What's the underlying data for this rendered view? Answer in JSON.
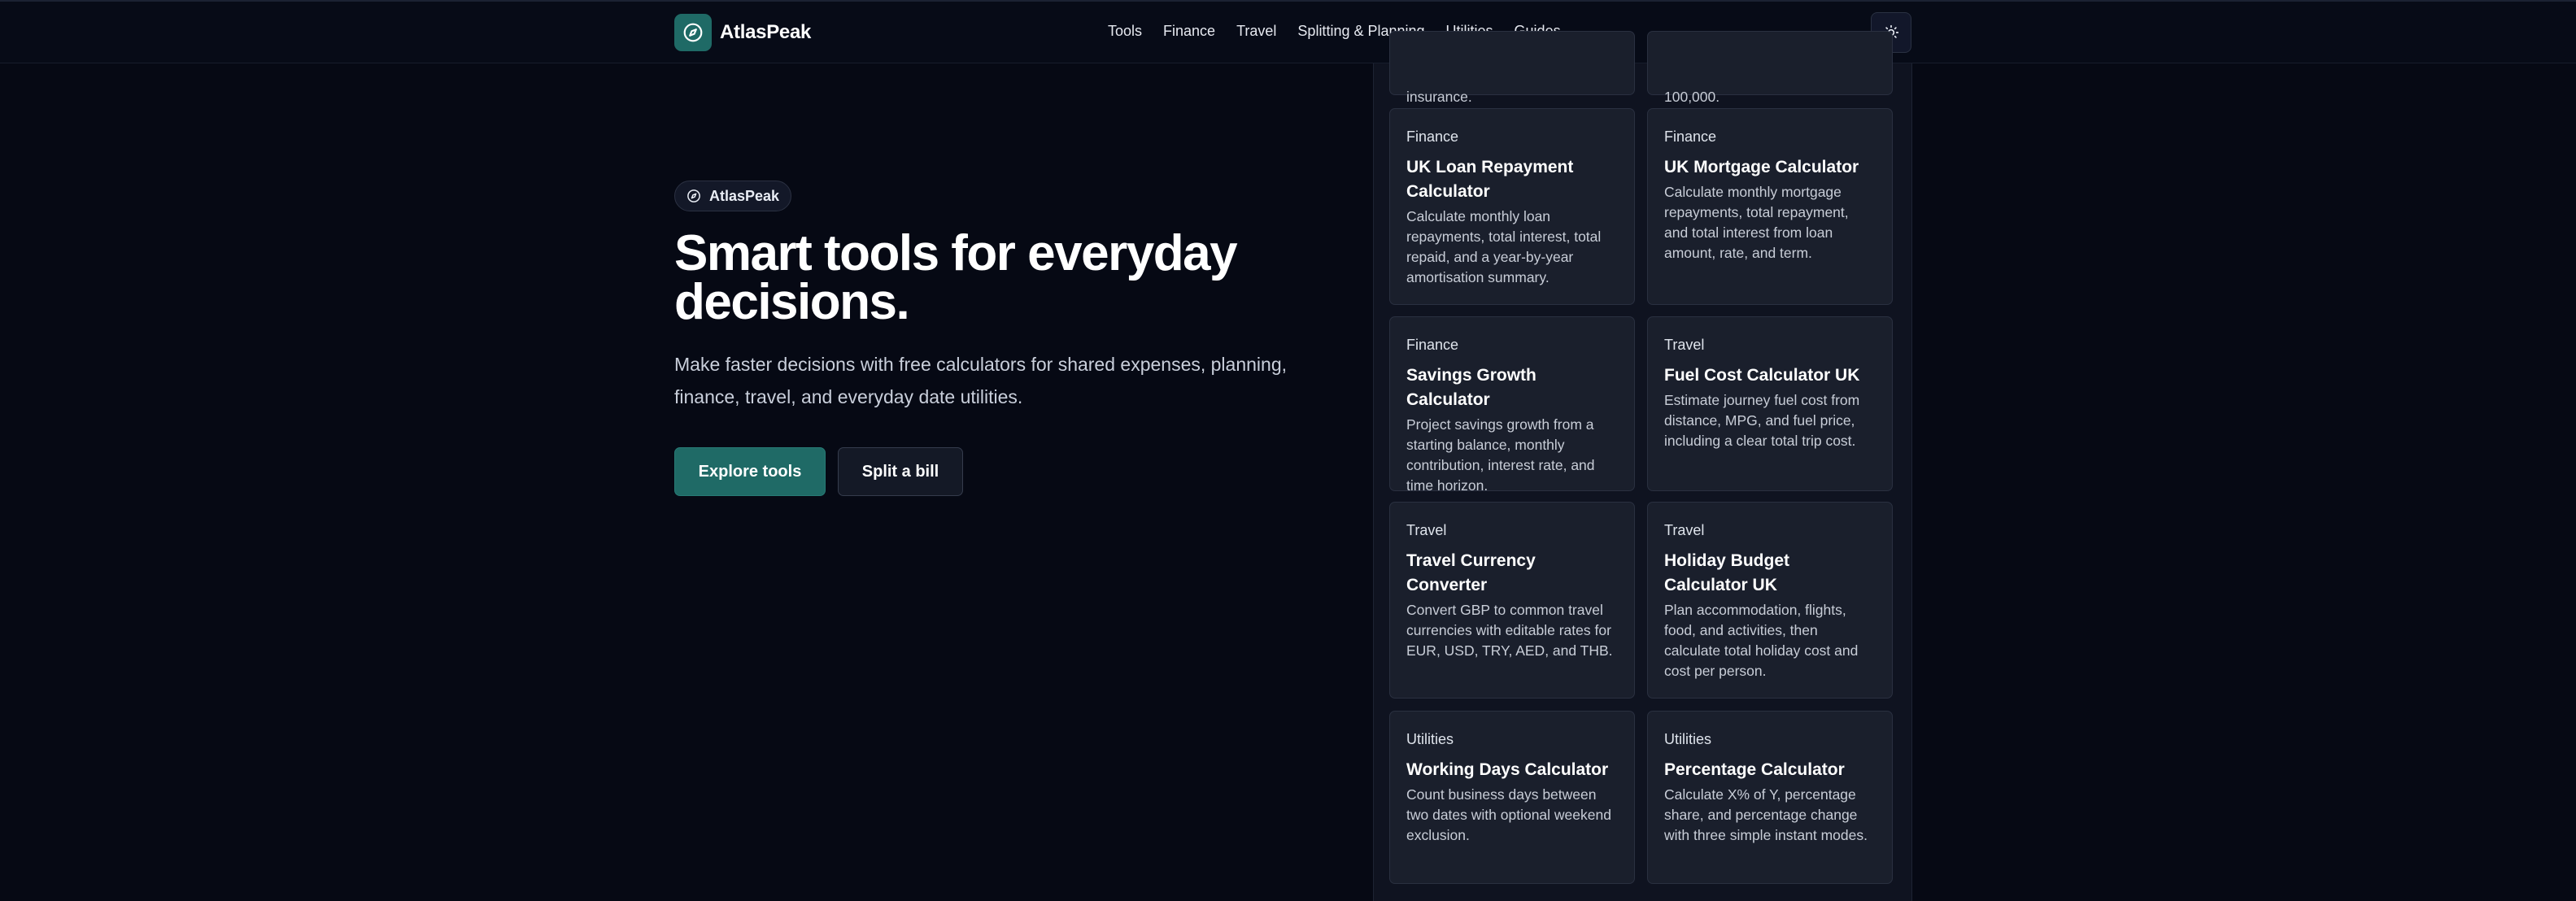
{
  "brand": {
    "name": "AtlasPeak",
    "accent": "#1f6a66",
    "background": "#060914",
    "card_bg": "#1a1f2c"
  },
  "nav": {
    "items": [
      "Tools",
      "Finance",
      "Travel",
      "Splitting & Planning",
      "Utilities",
      "Guides"
    ]
  },
  "header": {
    "theme_icon": "sun-icon",
    "logo_icon": "compass-icon"
  },
  "hero": {
    "badge": "AtlasPeak",
    "title": "Smart tools for everyday decisions.",
    "subtitle": "Make faster decisions with free calculators for shared expenses, planning, finance, travel, and everyday date utilities.",
    "primary_button": "Explore tools",
    "secondary_button": "Split a bill"
  },
  "cards_partial": [
    "insurance.",
    "100,000."
  ],
  "cards": [
    {
      "category": "Finance",
      "title": "UK Loan Repayment Calculator",
      "description": "Calculate monthly loan repayments, total interest, total repaid, and a year-by-year amortisation summary."
    },
    {
      "category": "Finance",
      "title": "UK Mortgage Calculator",
      "description": "Calculate monthly mortgage repayments, total repayment, and total interest from loan amount, rate, and term."
    },
    {
      "category": "Finance",
      "title": "Savings Growth Calculator",
      "description": "Project savings growth from a starting balance, monthly contribution, interest rate, and time horizon."
    },
    {
      "category": "Travel",
      "title": "Fuel Cost Calculator UK",
      "description": "Estimate journey fuel cost from distance, MPG, and fuel price, including a clear total trip cost."
    },
    {
      "category": "Travel",
      "title": "Travel Currency Converter",
      "description": "Convert GBP to common travel currencies with editable rates for EUR, USD, TRY, AED, and THB."
    },
    {
      "category": "Travel",
      "title": "Holiday Budget Calculator UK",
      "description": "Plan accommodation, flights, food, and activities, then calculate total holiday cost and cost per person."
    },
    {
      "category": "Utilities",
      "title": "Working Days Calculator",
      "description": "Count business days between two dates with optional weekend exclusion."
    },
    {
      "category": "Utilities",
      "title": "Percentage Calculator",
      "description": "Calculate X% of Y, percentage share, and percentage change with three simple instant modes."
    }
  ]
}
